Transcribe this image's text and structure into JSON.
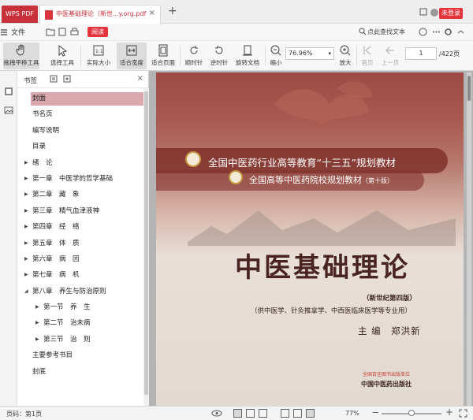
{
  "titlebar": {
    "app_tab": "WPS PDF",
    "doc_tab": "中医基础理论（新世...y.org.pdf",
    "login": "未登录"
  },
  "menubar": {
    "file": "文件",
    "read": "阅读",
    "find_placeholder": "点此查找文本"
  },
  "toolbar": {
    "pan_tool": "拖拽平移工具",
    "select_tool": "选择工具",
    "actual_size": "实际大小",
    "fit_width": "适合宽度",
    "fit_page": "适合页面",
    "clockwise": "顺时针",
    "counterclockwise": "逆时针",
    "rotate_doc": "旋转文档",
    "zoom_out": "缩小",
    "zoom_value": "76.96%",
    "zoom_in": "放大",
    "first_page": "首页",
    "prev_page": "上一页",
    "page_number": "1",
    "page_total": "/422页"
  },
  "bookmark_panel": {
    "title": "书签",
    "items": [
      {
        "label": "封面",
        "arrow": ""
      },
      {
        "label": "书名页",
        "arrow": ""
      },
      {
        "label": "编写说明",
        "arrow": ""
      },
      {
        "label": "目录",
        "arrow": ""
      },
      {
        "label": "绪　论",
        "arrow": "▶"
      },
      {
        "label": "第一章　中医学的哲学基础",
        "arrow": "▶"
      },
      {
        "label": "第二章　藏　象",
        "arrow": "▶"
      },
      {
        "label": "第三章　精气血津液神",
        "arrow": "▶"
      },
      {
        "label": "第四章　经　络",
        "arrow": "▶"
      },
      {
        "label": "第五章　体　质",
        "arrow": "▶"
      },
      {
        "label": "第六章　病　因",
        "arrow": "▶"
      },
      {
        "label": "第七章　病　机",
        "arrow": "▶"
      },
      {
        "label": "第八章　养生与防治原则",
        "arrow": "◢"
      },
      {
        "label": "第一节　养　生",
        "arrow": "▶"
      },
      {
        "label": "第二节　治未病",
        "arrow": "▶"
      },
      {
        "label": "第三节　治　则",
        "arrow": "▶"
      },
      {
        "label": "主要参考书目",
        "arrow": ""
      },
      {
        "label": "封底",
        "arrow": ""
      }
    ]
  },
  "cover": {
    "line1": "全国中医药行业高等教育“十三五”规划教材",
    "line2": "全国高等中医药院校规划教材",
    "line2_sub": "（第十版）",
    "title": "中医基础理论",
    "edition": "（新世纪第四版）",
    "subjects": "（供中医学、针灸推拿学、中西医临床医学等专业用）",
    "editor": "主 编　郑洪新",
    "publisher_seal": "全国百佳图书出版单位",
    "publisher": "中国中医药出版社"
  },
  "statusbar": {
    "page": "页码：第1页",
    "zoom": "77%",
    "zoom_level": 0.5
  },
  "colors": {
    "accent": "#c8303a",
    "selected_bookmark": "#d9a9ae",
    "cover_band": "#78281f"
  }
}
